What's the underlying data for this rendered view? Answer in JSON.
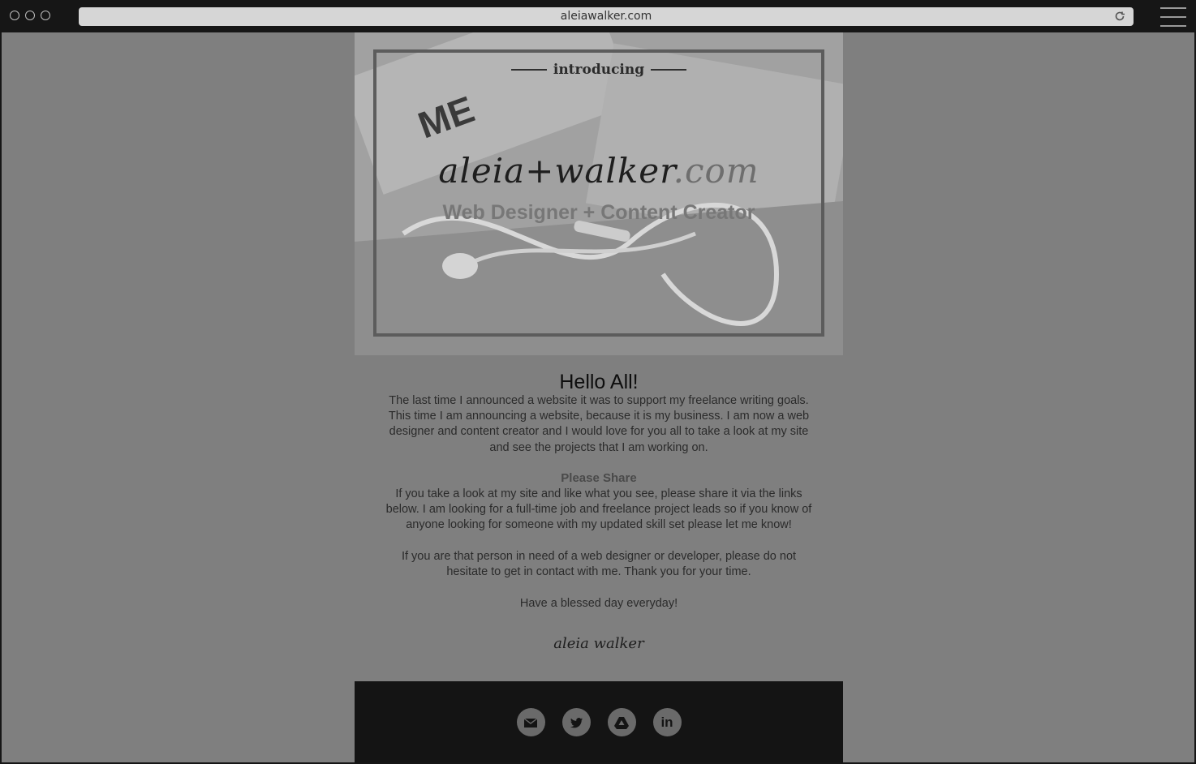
{
  "browser": {
    "url": "aleiawalker.com"
  },
  "hero": {
    "introducing": "introducing",
    "brand_name": "aleia+walker",
    "brand_tld": ".com",
    "tagline": "Web Designer + Content Creator"
  },
  "post": {
    "heading": "Hello All!",
    "paragraph_1": "The last time I announced a website it was to support my freelance writing goals. This time I am announcing a website, because it is my business. I am now a web designer and content creator and I would love for you all to take a look at my site and see the projects that I am working on.",
    "share_heading": "Please Share",
    "paragraph_2": "If you take a look at my site and like what you see, please share it via the links below. I am looking for a full-time job and freelance project leads so if you know of anyone looking for someone with my updated skill set please let me know!",
    "paragraph_3": "If you are that person in need of a web designer or developer, please do not hesitate to get in contact with me. Thank you for your time.",
    "paragraph_4": "Have a blessed day everyday!",
    "signature": "aleia walker"
  },
  "footer": {
    "social_icons": [
      "email-icon",
      "twitter-icon",
      "google-drive-icon",
      "linkedin-icon"
    ],
    "linkedin_label": "in"
  },
  "colors": {
    "overlay": "#7f7f7f",
    "footer_bg": "#141414",
    "chrome_bg": "#161616",
    "icon_circle": "#6a6a6a"
  }
}
